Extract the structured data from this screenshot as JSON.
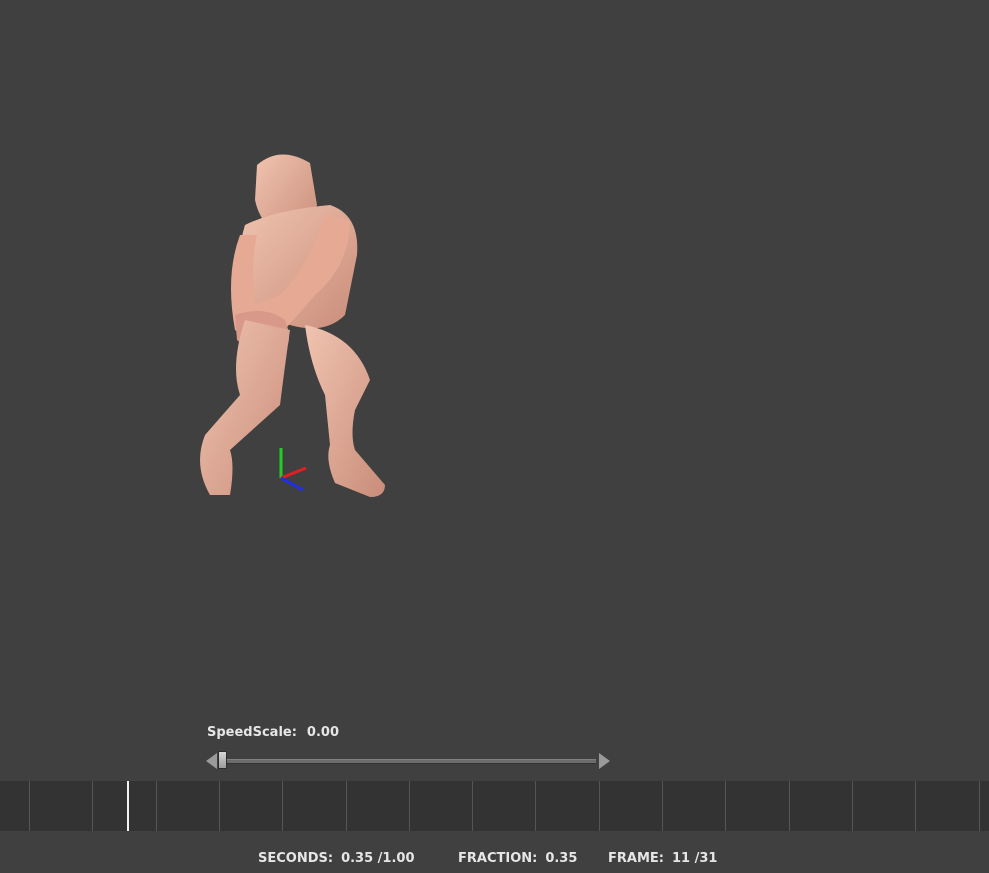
{
  "speed": {
    "label": "SpeedScale:",
    "value": "0.00",
    "fraction": 0.0
  },
  "timeline": {
    "current_frame": 11,
    "total_frames": 31
  },
  "status": {
    "seconds_label": "SECONDS:",
    "seconds_value": "0.35 /1.00",
    "fraction_label": "FRACTION:",
    "fraction_value": "0.35",
    "frame_label": "FRAME:",
    "frame_value": "11 /31"
  },
  "colors": {
    "background": "#404040",
    "skin": "#e8b5a0",
    "axis_x": "#e02020",
    "axis_y": "#20d020",
    "axis_z": "#2030e0"
  },
  "icons": {
    "model": "human-figure",
    "gizmo": "xyz-axis-gizmo"
  }
}
